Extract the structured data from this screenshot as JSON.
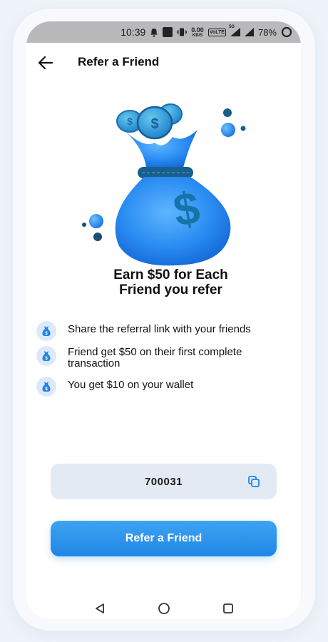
{
  "status_bar": {
    "time": "10:39",
    "net_speed_value": "0.00",
    "net_speed_unit": "KB/S",
    "volte_label": "VoLTE",
    "signal_label": "5G",
    "battery": "78%"
  },
  "app_bar": {
    "title": "Refer a Friend",
    "back_icon": "arrow-left-icon"
  },
  "hero": {
    "headline_line1": "Earn $50 for Each",
    "headline_line2": "Friend you refer"
  },
  "steps": [
    {
      "icon": "money-bag-icon",
      "text_line1": "Share the referral link with your friends",
      "text_line2": ""
    },
    {
      "icon": "money-bag-icon",
      "text_line1": "Friend get $50 on their first complete",
      "text_line2": "transaction"
    },
    {
      "icon": "money-bag-icon",
      "text_line1": "You get $10 on your wallet",
      "text_line2": ""
    }
  ],
  "referral": {
    "code": "700031",
    "copy_icon": "copy-icon"
  },
  "cta": {
    "label": "Refer a Friend"
  },
  "colors": {
    "accent": "#1f86e6",
    "accent_light": "#3ea3f2",
    "code_bg": "#e3eaf4",
    "status_bar_bg": "#b9b9bb"
  }
}
